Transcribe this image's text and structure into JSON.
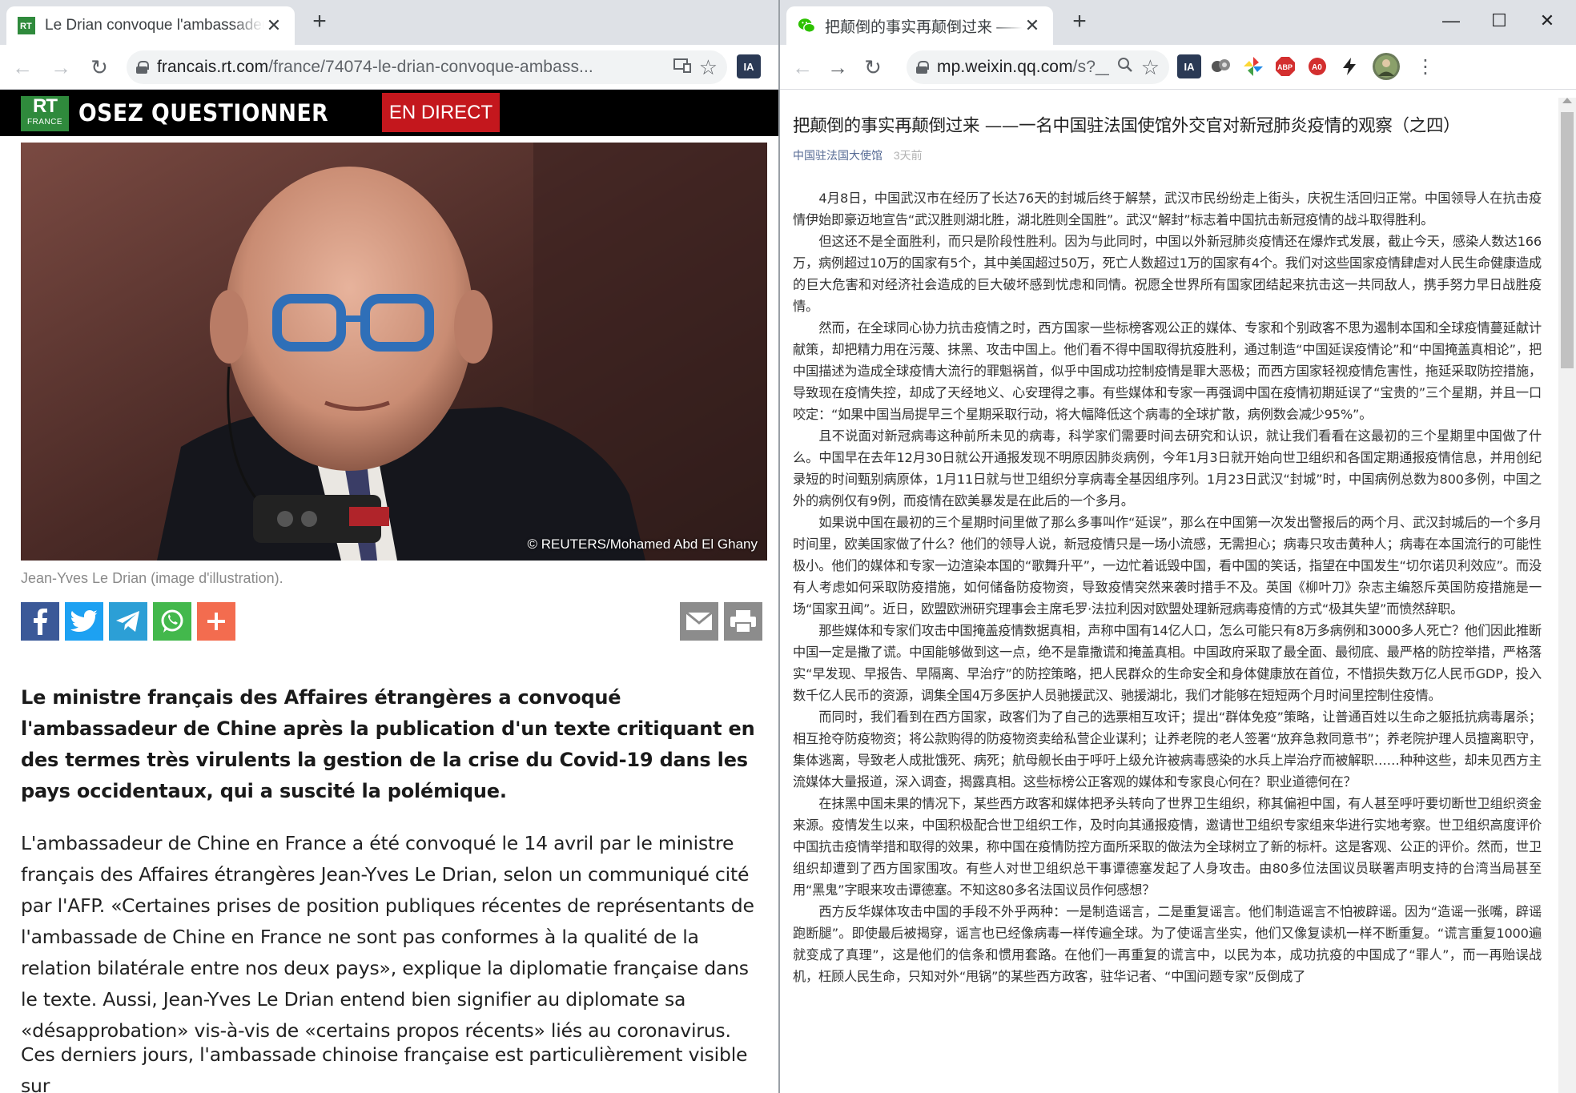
{
  "left_window": {
    "tab": {
      "title": "Le Drian convoque l'ambassadeur de Chine en France"
    },
    "toolbar": {
      "url_host": "francais.rt.com",
      "url_path": "/france/74074-le-drian-convoque-ambass...",
      "extension_label": "IA"
    },
    "page": {
      "logo_text": "RT",
      "logo_sub": "FRANCE",
      "slogan": "OSEZ QUESTIONNER",
      "live_button": "EN DIRECT",
      "photo_credit": "© REUTERS/Mohamed Abd El Ghany",
      "caption": "Jean-Yves Le Drian (image d'illustration).",
      "lead": "Le ministre français des Affaires étrangères a convoqué l'ambassadeur de Chine après la publication d'un texte critiquant en des termes très virulents la gestion de la crise du Covid-19 dans les pays occidentaux, qui a suscité la polémique.",
      "paragraph_1": "L'ambassadeur de Chine en France a été convoqué le 14 avril par le ministre français des Affaires étrangères Jean-Yves Le Drian, selon un communiqué cité par l'AFP. «Certaines prises de position publiques récentes de représentants de l'ambassade de Chine en France ne sont pas conformes à la qualité de la relation bilatérale entre nos deux pays», explique la diplomatie française dans le texte. Aussi, Jean-Yves Le Drian entend bien signifier au diplomate sa «désapprobation» vis-à-vis de «certains propos récents» liés au coronavirus.",
      "paragraph_2": "Ces derniers jours, l'ambassade chinoise française est particulièrement visible sur"
    }
  },
  "right_window": {
    "tab": {
      "title": "把颠倒的事实再颠倒过来 ——一名中国驻法国使馆外交官"
    },
    "toolbar": {
      "url_host": "mp.weixin.qq.com",
      "url_path": "/s?__...",
      "extension_label": "IA"
    },
    "article": {
      "title": "把颠倒的事实再颠倒过来 ——一名中国驻法国使馆外交官对新冠肺炎疫情的观察（之四）",
      "account": "中国驻法国大使馆",
      "time": "3天前",
      "paragraphs": [
        "4月8日，中国武汉市在经历了长达76天的封城后终于解禁，武汉市民纷纷走上街头，庆祝生活回归正常。中国领导人在抗击疫情伊始即豪迈地宣告“武汉胜则湖北胜，湖北胜则全国胜”。武汉“解封”标志着中国抗击新冠疫情的战斗取得胜利。",
        "但这还不是全面胜利，而只是阶段性胜利。因为与此同时，中国以外新冠肺炎疫情还在爆炸式发展，截止今天，感染人数达166万，病例超过10万的国家有5个，其中美国超过50万，死亡人数超过1万的国家有4个。我们对这些国家疫情肆虐对人民生命健康造成的巨大危害和对经济社会造成的巨大破坏感到忧虑和同情。祝愿全世界所有国家团结起来抗击这一共同敌人，携手努力早日战胜疫情。",
        "然而，在全球同心协力抗击疫情之时，西方国家一些标榜客观公正的媒体、专家和个别政客不思为遏制本国和全球疫情蔓延献计献策，却把精力用在污蔑、抹黑、攻击中国上。他们看不得中国取得抗疫胜利，通过制造“中国延误疫情论”和“中国掩盖真相论”，把中国描述为造成全球疫情大流行的罪魁祸首，似乎中国成功控制疫情是罪大恶极；而西方国家轻视疫情危害性，拖延采取防控措施，导致现在疫情失控，却成了天经地义、心安理得之事。有些媒体和专家一再强调中国在疫情初期延误了“宝贵的”三个星期，并且一口咬定：“如果中国当局提早三个星期采取行动，将大幅降低这个病毒的全球扩散，病例数会减少95%”。",
        "且不说面对新冠病毒这种前所未见的病毒，科学家们需要时间去研究和认识，就让我们看看在这最初的三个星期里中国做了什么。中国早在去年12月30日就公开通报发现不明原因肺炎病例，今年1月3日就开始向世卫组织和各国定期通报疫情信息，并用创纪录短的时间甄别病原体，1月11日就与世卫组织分享病毒全基因组序列。1月23日武汉“封城”时，中国病例总数为800多例，中国之外的病例仅有9例，而疫情在欧美暴发是在此后的一个多月。",
        "如果说中国在最初的三个星期时间里做了那么多事叫作“延误”，那么在中国第一次发出警报后的两个月、武汉封城后的一个多月时间里，欧美国家做了什么？他们的领导人说，新冠疫情只是一场小流感，无需担心；病毒只攻击黄种人；病毒在本国流行的可能性极小。他们的媒体和专家一边渲染本国的“歌舞升平”，一边忙着诋毁中国，看中国的笑话，指望在中国发生“切尔诺贝利效应”。而没有人考虑如何采取防疫措施，如何储备防疫物资，导致疫情突然来袭时措手不及。英国《柳叶刀》杂志主编怒斥英国防疫措施是一场“国家丑闻”。近日，欧盟欧洲研究理事会主席毛罗·法拉利因对欧盟处理新冠病毒疫情的方式“极其失望”而愤然辞职。",
        "那些媒体和专家们攻击中国掩盖疫情数据真相，声称中国有14亿人口，怎么可能只有8万多病例和3000多人死亡？他们因此推断中国一定是撒了谎。中国能够做到这一点，绝不是靠撒谎和掩盖真相。中国政府采取了最全面、最彻底、最严格的防控举措，严格落实“早发现、早报告、早隔离、早治疗”的防控策略，把人民群众的生命安全和身体健康放在首位，不惜损失数万亿人民币GDP，投入数千亿人民币的资源，调集全国4万多医护人员驰援武汉、驰援湖北，我们才能够在短短两个月时间里控制住疫情。",
        "而同时，我们看到在西方国家，政客们为了自己的选票相互攻讦；提出“群体免疫”策略，让普通百姓以生命之躯抵抗病毒屠杀；相互抢夺防疫物资；将公款购得的防疫物资卖给私营企业谋利；让养老院的老人签署“放弃急救同意书”；养老院护理人员擅离职守，集体逃离，导致老人成批饿死、病死；航母舰长由于呼吁上级允许被病毒感染的水兵上岸治疗而被解职……种种这些，却未见西方主流媒体大量报道，深入调查，揭露真相。这些标榜公正客观的媒体和专家良心何在？职业道德何在？",
        "在抹黑中国未果的情况下，某些西方政客和媒体把矛头转向了世界卫生组织，称其偏袒中国，有人甚至呼吁要切断世卫组织资金来源。疫情发生以来，中国积极配合世卫组织工作，及时向其通报疫情，邀请世卫组织专家组来华进行实地考察。世卫组织高度评价中国抗击疫情举措和取得的效果，称中国在疫情防控方面所采取的做法为全球树立了新的标杆。这是客观、公正的评价。然而，世卫组织却遭到了西方国家围攻。有些人对世卫组织总干事谭德塞发起了人身攻击。由80多位法国议员联署声明支持的台湾当局甚至用“黑鬼”字眼来攻击谭德塞。不知这80多名法国议员作何感想？",
        "西方反华媒体攻击中国的手段不外乎两种：一是制造谣言，二是重复谣言。他们制造谣言不怕被辟谣。因为“造谣一张嘴，辟谣跑断腿”。即使最后被揭穿，谣言也已经像病毒一样传遍全球。为了使谣言坐实，他们又像复读机一样不断重复。“谎言重复1000遍就变成了真理”，这是他们的信条和惯用套路。在他们一再重复的谎言中，以民为本，成功抗疫的中国成了“罪人”，而一再贻误战机，枉顾人民生命，只知对外“甩锅”的某些西方政客，驻华记者、“中国问题专家”反倒成了"
      ]
    }
  },
  "colors": {
    "chrome_tabstrip": "#dee1e6",
    "rt_green": "#2f8a3c",
    "rt_live_red": "#c4171d",
    "wechat_link": "#576b95",
    "facebook": "#3b5998",
    "twitter": "#1da1f2",
    "telegram": "#2c9fd6",
    "whatsapp": "#43b84c",
    "plus": "#f36c4f",
    "email_print": "#8c8c8c"
  },
  "icons": {
    "share": [
      "facebook-icon",
      "twitter-icon",
      "telegram-icon",
      "whatsapp-icon",
      "plus-icon",
      "email-icon",
      "print-icon"
    ]
  }
}
